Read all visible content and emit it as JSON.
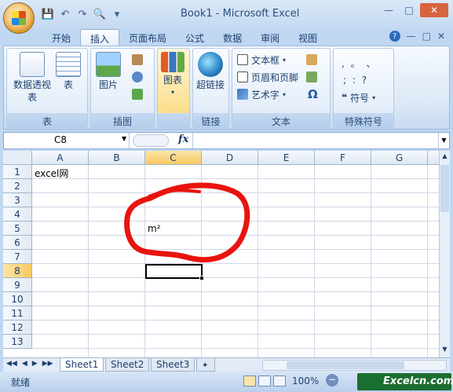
{
  "window": {
    "title": "Book1 - Microsoft Excel"
  },
  "ribbon_tabs": [
    "开始",
    "插入",
    "页面布局",
    "公式",
    "数据",
    "审阅",
    "视图"
  ],
  "active_tab": "插入",
  "groups": {
    "table": {
      "label": "表",
      "pivot": "数据透视表",
      "table": "表"
    },
    "illustrations": {
      "label": "插图",
      "picture": "图片"
    },
    "charts": {
      "label": "",
      "chart": "图表"
    },
    "links": {
      "label": "链接",
      "hyperlink": "超链接"
    },
    "text": {
      "label": "文本",
      "textbox": "文本框",
      "header_footer": "页眉和页脚",
      "wordart": "艺术字",
      "omega": "Ω"
    },
    "symbols": {
      "label": "特殊符号",
      "row1": ",  。  、",
      "row2": ";  :  ?",
      "symbol": "符号"
    }
  },
  "formula_bar": {
    "name_box": "C8",
    "fx": "fx",
    "formula": ""
  },
  "columns": [
    "A",
    "B",
    "C",
    "D",
    "E",
    "F",
    "G"
  ],
  "selected_column": "C",
  "rows": [
    "1",
    "2",
    "3",
    "4",
    "5",
    "6",
    "7",
    "8",
    "9",
    "10",
    "11",
    "12",
    "13"
  ],
  "selected_row": "8",
  "cells": {
    "A1": "excel网",
    "C5": "m²"
  },
  "sheets": [
    "Sheet1",
    "Sheet2",
    "Sheet3"
  ],
  "active_sheet": "Sheet1",
  "status": {
    "ready": "就绪",
    "zoom": "100%"
  },
  "watermark": "Excelcn.com",
  "colors": {
    "annotation_stroke": "#e8140e",
    "brand_bg": "#1a6e2f"
  }
}
